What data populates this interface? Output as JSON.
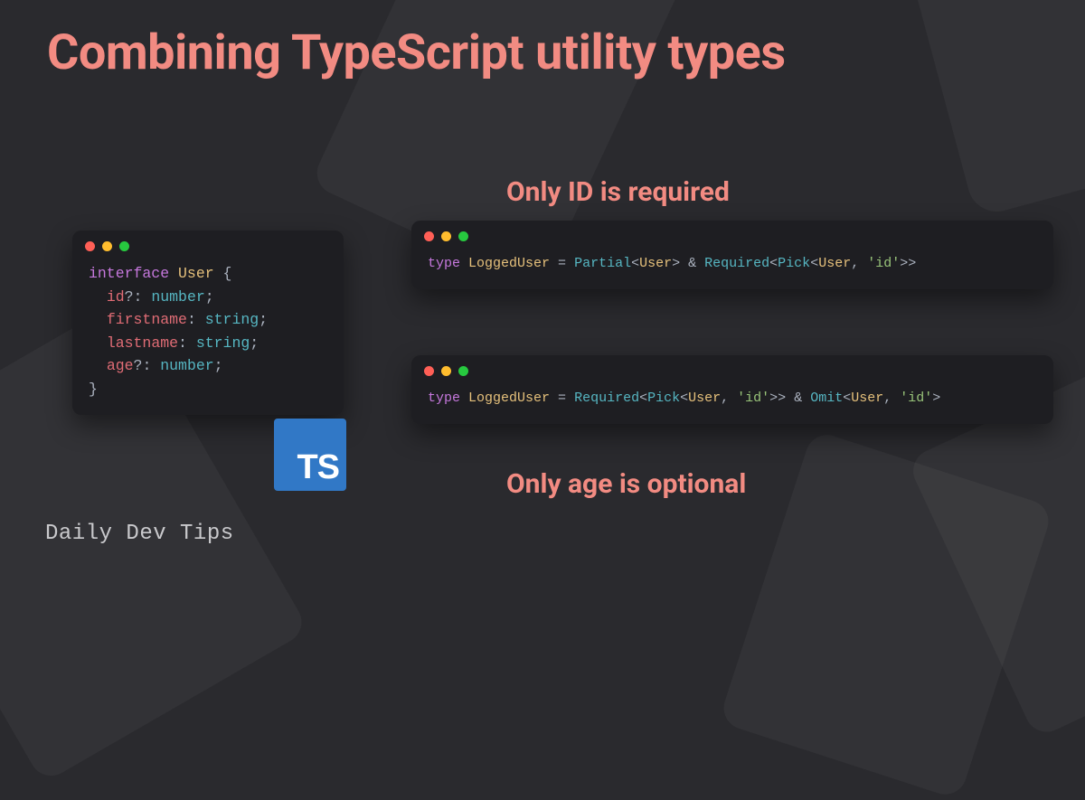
{
  "title": "Combining TypeScript utility types",
  "subtitle1": "Only ID is required",
  "subtitle2": "Only age is optional",
  "brand": "Daily Dev Tips",
  "ts_badge": "TS",
  "code_left": {
    "keyword": "interface",
    "name": "User",
    "open": " {",
    "lines": [
      {
        "prop": "id",
        "opt": "?",
        "type": "number"
      },
      {
        "prop": "firstname",
        "opt": "",
        "type": "string"
      },
      {
        "prop": "lastname",
        "opt": "",
        "type": "string"
      },
      {
        "prop": "age",
        "opt": "?",
        "type": "number"
      }
    ],
    "close": "}"
  },
  "code_r1": {
    "kw": "type",
    "name": "LoggedUser",
    "eq": " = ",
    "a": "Partial",
    "a_arg": "User",
    "amp": " & ",
    "b": "Required",
    "c": "Pick",
    "c_arg1": "User",
    "c_arg2": "'id'"
  },
  "code_r2": {
    "kw": "type",
    "name": "LoggedUser",
    "eq": " = ",
    "a": "Required",
    "b": "Pick",
    "b_arg1": "User",
    "b_arg2": "'id'",
    "amp": " & ",
    "c": "Omit",
    "c_arg1": "User",
    "c_arg2": "'id'"
  }
}
